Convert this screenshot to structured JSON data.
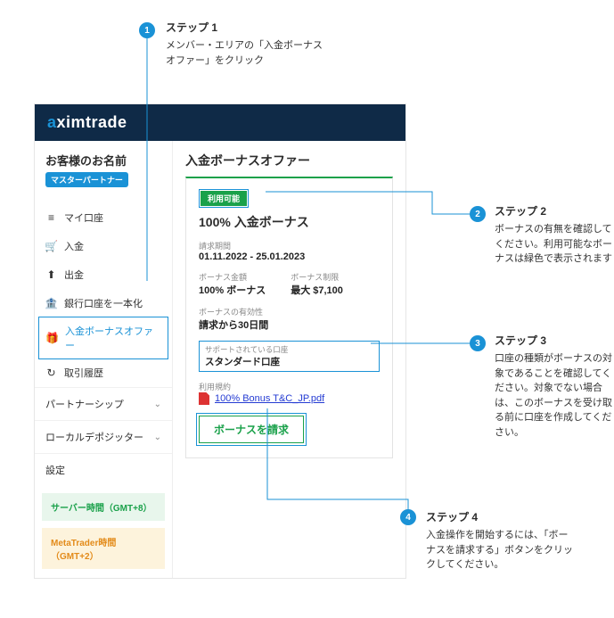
{
  "steps": [
    {
      "num": "1",
      "title": "ステップ 1",
      "text": "メンバー・エリアの「入金ボーナスオファー」をクリック"
    },
    {
      "num": "2",
      "title": "ステップ 2",
      "text": "ボーナスの有無を確認してください。利用可能なボーナスは緑色で表示されます"
    },
    {
      "num": "3",
      "title": "ステップ 3",
      "text": "口座の種類がボーナスの対象であることを確認してください。対象でない場合は、このボーナスを受け取る前に口座を作成してください。"
    },
    {
      "num": "4",
      "title": "ステップ 4",
      "text": "入金操作を開始するには、「ボーナスを請求する」ボタンをクリックしてください。"
    }
  ],
  "brand": {
    "prefix": "a",
    "rest": "ximtrade"
  },
  "customer": {
    "name": "お客様のお名前",
    "badge": "マスターパートナー"
  },
  "nav": {
    "myaccount": "マイ口座",
    "deposit": "入金",
    "withdraw": "出金",
    "consolidate": "銀行口座を一本化",
    "bonus": "入金ボーナスオファー",
    "history": "取引履歴"
  },
  "exp": {
    "partnership": "パートナーシップ",
    "localdep": "ローカルデポジッター",
    "settings": "設定"
  },
  "servers": {
    "gmt8": "サーバー時間（GMT+8）",
    "mt": "MetaTrader時間（GMT+2）"
  },
  "content": {
    "title": "入金ボーナスオファー",
    "avail": "利用可能",
    "bonus_title": "100% 入金ボーナス",
    "period_lbl": "請求期間",
    "period_val": "01.11.2022 - 25.01.2023",
    "amount_lbl": "ボーナス金額",
    "amount_val": "100% ボーナス",
    "limit_lbl": "ボーナス制限",
    "limit_val": "最大 $7,100",
    "validity_lbl": "ボーナスの有効性",
    "validity_val": "請求から30日間",
    "acct_lbl": "サポートされている口座",
    "acct_val": "スタンダード口座",
    "terms_lbl": "利用規約",
    "pdf": "100% Bonus T&C_JP.pdf",
    "claim": "ボーナスを請求"
  }
}
